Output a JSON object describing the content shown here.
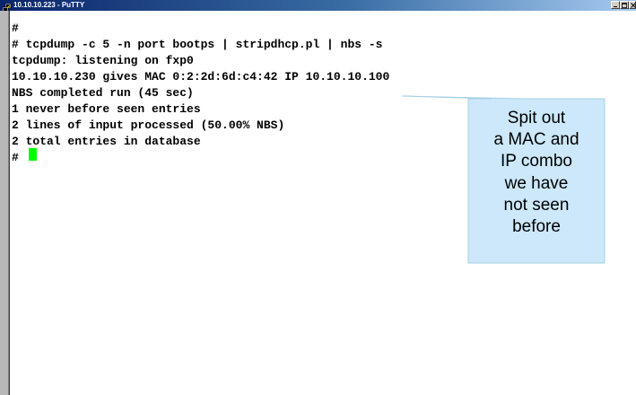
{
  "window": {
    "title": "10.10.10.223 - PuTTY"
  },
  "terminal": {
    "lines": [
      "#",
      "# tcpdump -c 5 -n port bootps | stripdhcp.pl | nbs -s",
      "tcpdump: listening on fxp0",
      "10.10.10.230 gives MAC 0:2:2d:6d:c4:42 IP 10.10.10.100",
      "NBS completed run (45 sec)",
      "1 never before seen entries",
      "2 lines of input processed (50.00% NBS)",
      "2 total entries in database",
      "#"
    ],
    "cursor_color": "#00ff00"
  },
  "callout": {
    "lines": [
      "Spit out",
      "a MAC and",
      "IP combo",
      "we have",
      "not seen",
      "before"
    ],
    "fill_color": "#cce8fa"
  },
  "colors": {
    "titlebar_start": "#0a246a",
    "titlebar_end": "#a6caf0",
    "terminal_bg": "#ffffff",
    "terminal_text": "#000000"
  },
  "icons": {
    "app": "putty-icon",
    "minimize": "minimize-icon",
    "maximize": "maximize-icon",
    "close": "close-icon"
  }
}
